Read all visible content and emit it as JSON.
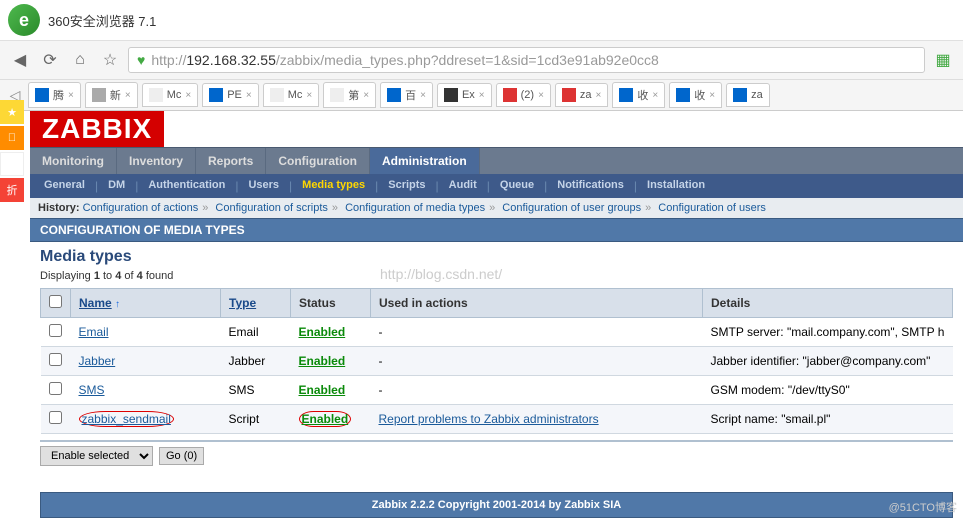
{
  "browser": {
    "title": "360安全浏览器 7.1",
    "url_prefix": "http://",
    "url_host": "192.168.32.55",
    "url_path": "/zabbix/media_types.php?ddreset=1&sid=1cd3e91ab92e0cc8",
    "tabs": [
      "腾",
      "新",
      "Mc",
      "PE",
      "Mc",
      "第",
      "百",
      "Ex",
      "(2)",
      "za",
      "收",
      "收",
      "za"
    ]
  },
  "logo_text": "ZABBIX",
  "menu1": [
    "Monitoring",
    "Inventory",
    "Reports",
    "Configuration",
    "Administration"
  ],
  "menu1_active": 4,
  "menu2": [
    "General",
    "DM",
    "Authentication",
    "Users",
    "Media types",
    "Scripts",
    "Audit",
    "Queue",
    "Notifications",
    "Installation"
  ],
  "menu2_active": 4,
  "history": {
    "label": "History:",
    "items": [
      "Configuration of actions",
      "Configuration of scripts",
      "Configuration of media types",
      "Configuration of user groups",
      "Configuration of users"
    ]
  },
  "cfg_header": "CONFIGURATION OF MEDIA TYPES",
  "page_title": "Media types",
  "displaying_prefix": "Displaying",
  "displaying_from": "1",
  "displaying_to": "4",
  "displaying_of": "of",
  "displaying_total": "4",
  "displaying_suffix": "found",
  "cols": {
    "name": "Name",
    "type": "Type",
    "status": "Status",
    "used": "Used in actions",
    "details": "Details"
  },
  "rows": [
    {
      "name": "Email",
      "type": "Email",
      "status": "Enabled",
      "used": "-",
      "details": "SMTP server: \"mail.company.com\", SMTP h"
    },
    {
      "name": "Jabber",
      "type": "Jabber",
      "status": "Enabled",
      "used": "-",
      "details": "Jabber identifier: \"jabber@company.com\""
    },
    {
      "name": "SMS",
      "type": "SMS",
      "status": "Enabled",
      "used": "-",
      "details": "GSM modem: \"/dev/ttyS0\""
    },
    {
      "name": "zabbix_sendmail",
      "type": "Script",
      "status": "Enabled",
      "used_link": "Report problems to Zabbix administrators",
      "details": "Script name: \"smail.pl\""
    }
  ],
  "select_action": "Enable selected",
  "go_btn": "Go (0)",
  "footer": "Zabbix 2.2.2 Copyright 2001-2014 by Zabbix SIA",
  "watermark": "http://blog.csdn.net/",
  "corner": "@51CTO博客"
}
